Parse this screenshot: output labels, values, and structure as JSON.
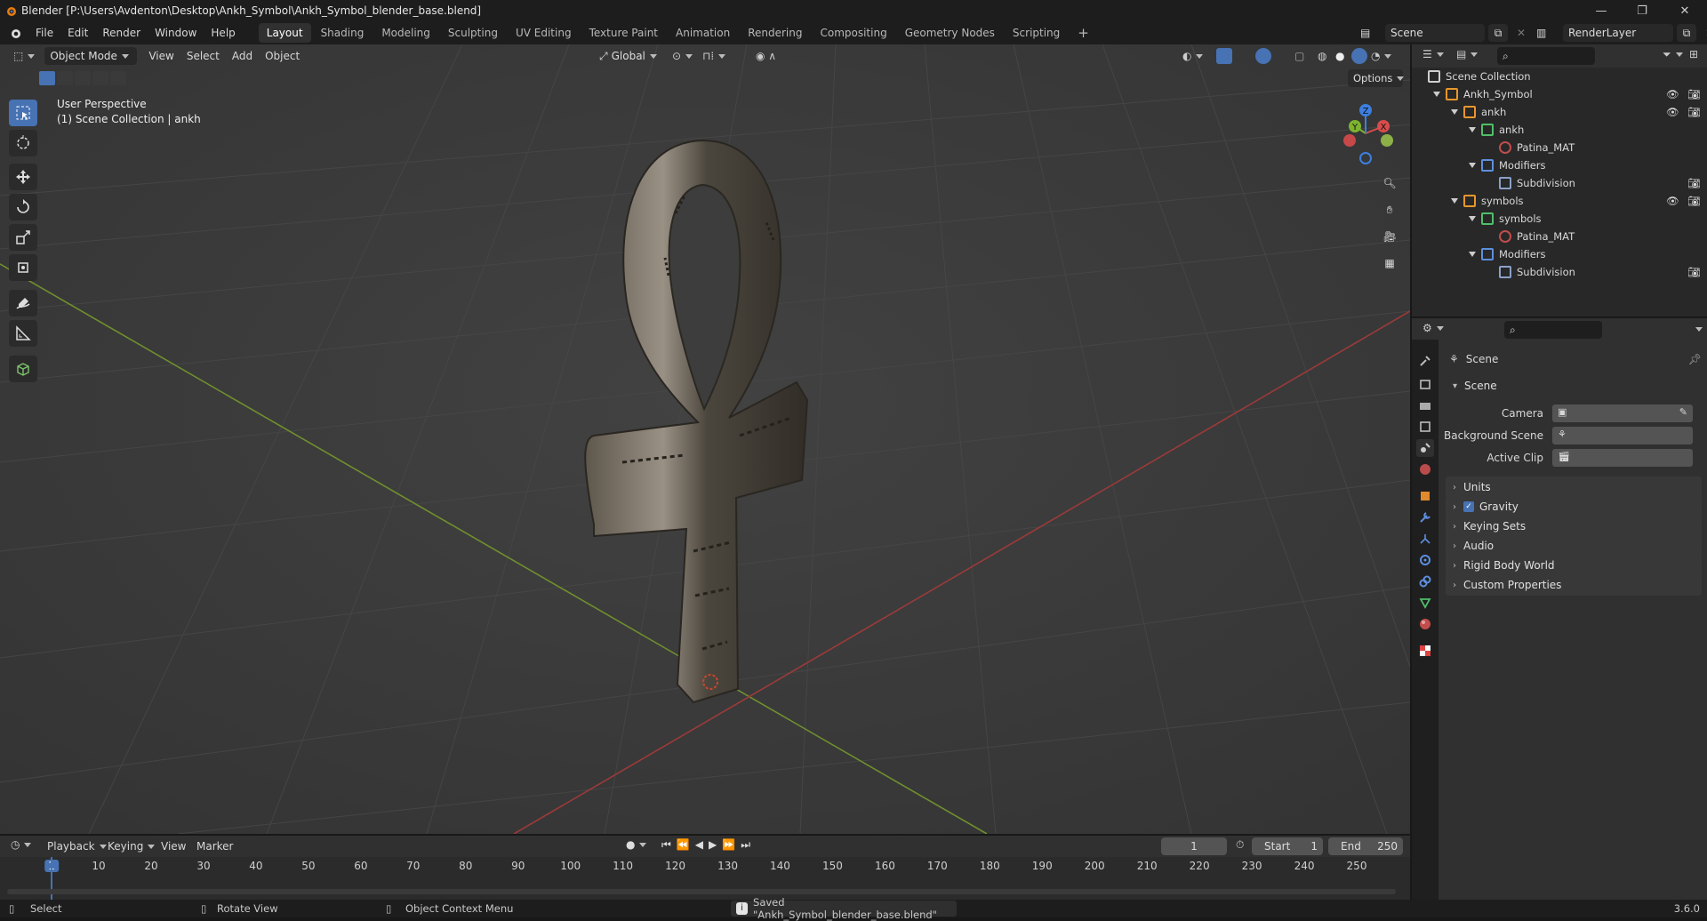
{
  "window": {
    "title": "Blender [P:\\Users\\Avdenton\\Desktop\\Ankh_Symbol\\Ankh_Symbol_blender_base.blend]",
    "controls": [
      "minimize-icon",
      "maximize-icon",
      "close-icon"
    ]
  },
  "menu": [
    "File",
    "Edit",
    "Render",
    "Window",
    "Help"
  ],
  "workspaces": [
    {
      "label": "Layout",
      "active": true
    },
    {
      "label": "Shading"
    },
    {
      "label": "Modeling"
    },
    {
      "label": "Sculpting"
    },
    {
      "label": "UV Editing"
    },
    {
      "label": "Texture Paint"
    },
    {
      "label": "Animation"
    },
    {
      "label": "Rendering"
    },
    {
      "label": "Compositing"
    },
    {
      "label": "Geometry Nodes"
    },
    {
      "label": "Scripting"
    }
  ],
  "add_workspace": "+",
  "scene_selector": "Scene",
  "view_layer_selector": "RenderLayer",
  "viewport": {
    "mode": "Object Mode",
    "menus": [
      "View",
      "Select",
      "Add",
      "Object"
    ],
    "orientation": "Global",
    "options": "Options",
    "info_line1": "User Perspective",
    "info_line2": "(1) Scene Collection | ankh",
    "gizmo": {
      "x": "X",
      "y": "Y",
      "z": "Z"
    },
    "tools": [
      "select-box-icon",
      "cursor-icon",
      "move-icon",
      "rotate-icon",
      "scale-icon",
      "transform-icon",
      "annotate-icon",
      "measure-icon",
      "add-cube-icon"
    ]
  },
  "outliner": {
    "rows": [
      {
        "label": "Scene Collection",
        "depth": 0,
        "icon": "collection-icon"
      },
      {
        "label": "Ankh_Symbol",
        "depth": 1,
        "icon": "empty-icon",
        "eye": true,
        "cam": true
      },
      {
        "label": "ankh",
        "depth": 2,
        "icon": "mesh-object-icon",
        "eye": true,
        "cam": true
      },
      {
        "label": "ankh",
        "depth": 3,
        "icon": "mesh-data-icon"
      },
      {
        "label": "Patina_MAT",
        "depth": 4,
        "icon": "material-icon"
      },
      {
        "label": "Modifiers",
        "depth": 3,
        "icon": "wrench-icon"
      },
      {
        "label": "Subdivision",
        "depth": 4,
        "icon": "modifier-icon",
        "cam": true
      },
      {
        "label": "symbols",
        "depth": 2,
        "icon": "mesh-object-icon",
        "eye": true,
        "cam": true
      },
      {
        "label": "symbols",
        "depth": 3,
        "icon": "mesh-data-icon"
      },
      {
        "label": "Patina_MAT",
        "depth": 4,
        "icon": "material-icon"
      },
      {
        "label": "Modifiers",
        "depth": 3,
        "icon": "wrench-icon"
      },
      {
        "label": "Subdivision",
        "depth": 4,
        "icon": "modifier-icon",
        "cam": true
      }
    ]
  },
  "properties": {
    "context": "Scene",
    "panel": "Scene",
    "fields": [
      {
        "label": "Camera"
      },
      {
        "label": "Background Scene"
      },
      {
        "label": "Active Clip"
      }
    ],
    "sections": [
      {
        "label": "Units",
        "checkbox": false
      },
      {
        "label": "Gravity",
        "checkbox": true
      },
      {
        "label": "Keying Sets",
        "checkbox": false
      },
      {
        "label": "Audio",
        "checkbox": false
      },
      {
        "label": "Rigid Body World",
        "checkbox": false
      },
      {
        "label": "Custom Properties",
        "checkbox": false
      }
    ]
  },
  "timeline": {
    "menus": [
      "Playback",
      "Keying",
      "View",
      "Marker"
    ],
    "current_frame": "1",
    "start_label": "Start",
    "start": "1",
    "end_label": "End",
    "end": "250",
    "ticks": [
      "1",
      "10",
      "20",
      "30",
      "40",
      "50",
      "60",
      "70",
      "80",
      "90",
      "100",
      "110",
      "120",
      "130",
      "140",
      "150",
      "160",
      "170",
      "180",
      "190",
      "200",
      "210",
      "220",
      "230",
      "240",
      "250"
    ]
  },
  "status": {
    "hint1": "Select",
    "hint2": "Rotate View",
    "hint3": "Object Context Menu",
    "message": "Saved \"Ankh_Symbol_blender_base.blend\"",
    "version": "3.6.0"
  },
  "colors": {
    "accent": "#4772b3",
    "x_axis": "#d94c4c",
    "y_axis": "#7db32f",
    "z_axis": "#3d7fe0"
  }
}
